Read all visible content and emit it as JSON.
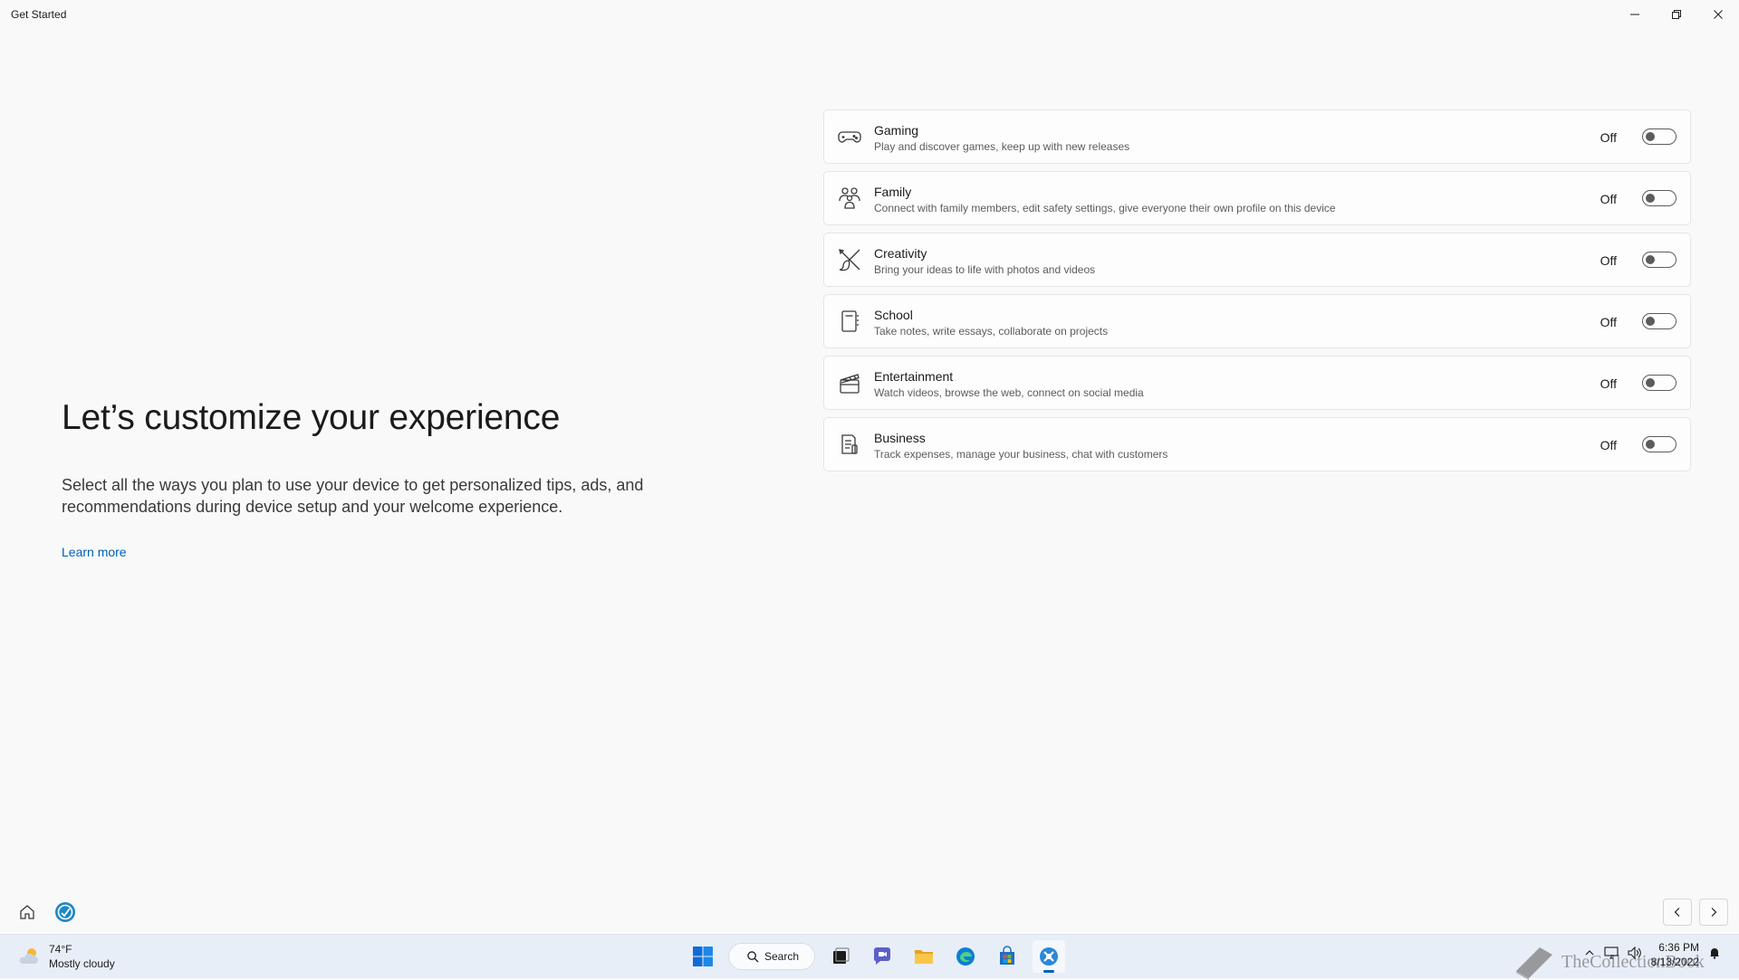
{
  "window": {
    "title": "Get Started"
  },
  "hero": {
    "title": "Let’s customize your experience",
    "description": "Select all the ways you plan to use your device to get personalized tips, ads, and recommendations during device setup and your welcome experience.",
    "learn_more": "Learn more"
  },
  "options": [
    {
      "icon": "gamepad-icon",
      "title": "Gaming",
      "description": "Play and discover games, keep up with new releases",
      "state": "Off"
    },
    {
      "icon": "family-icon",
      "title": "Family",
      "description": "Connect with family members, edit safety settings, give everyone their own profile on this device",
      "state": "Off"
    },
    {
      "icon": "brush-icon",
      "title": "Creativity",
      "description": "Bring your ideas to life with photos and videos",
      "state": "Off"
    },
    {
      "icon": "notebook-icon",
      "title": "School",
      "description": "Take notes, write essays, collaborate on projects",
      "state": "Off"
    },
    {
      "icon": "clapperboard-icon",
      "title": "Entertainment",
      "description": "Watch videos, browse the web, connect on social media",
      "state": "Off"
    },
    {
      "icon": "document-icon",
      "title": "Business",
      "description": "Track expenses, manage your business, chat with customers",
      "state": "Off"
    }
  ],
  "taskbar": {
    "weather_temp": "74°F",
    "weather_desc": "Mostly cloudy",
    "search_label": "Search",
    "time": "6:36 PM",
    "date": "8/13/2022",
    "watermark": "TheCollectionBook"
  },
  "colors": {
    "accent": "#005fb8",
    "toggle_off": "#5c5c5c"
  }
}
